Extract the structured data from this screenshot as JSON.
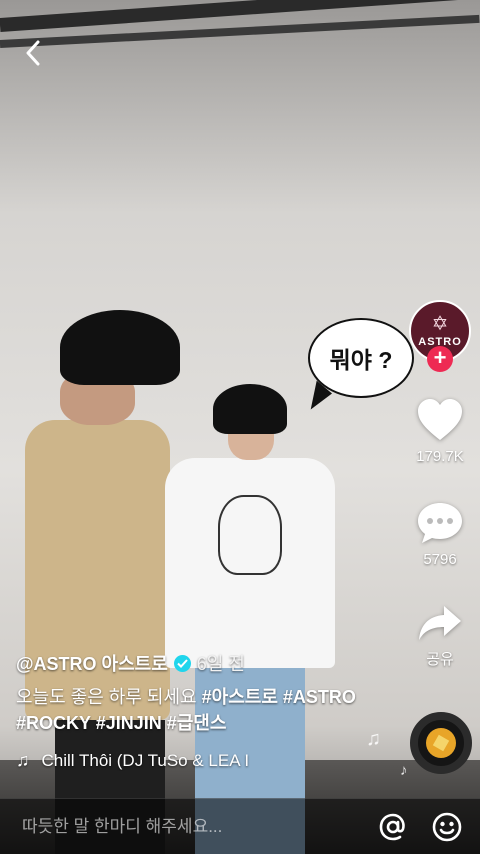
{
  "bubble_text": "뭐야 ?",
  "profile": {
    "avatar_text": "ASTRO",
    "follow_symbol": "+"
  },
  "rail": {
    "likes": "179.7K",
    "comments": "5796",
    "share_label": "공유"
  },
  "post": {
    "author": "@ASTRO 아스트로",
    "age": "6일 전",
    "text": "오늘도 좋은 하루 되세요",
    "hashtags_line1": "#아스트로 #ASTRO",
    "hashtags_line2": "#ROCKY #JINJIN #급댄스",
    "music": "Chill Thôi (DJ TuSo & LEA I"
  },
  "comment": {
    "placeholder": "따듯한 말 한마디 해주세요..."
  },
  "colors": {
    "accent": "#ee2a53",
    "verified": "#20d5ec",
    "avatar_bg": "#5a1a2a"
  },
  "icons": {
    "back": "chevron-left-icon",
    "like": "heart-icon",
    "comment": "speech-bubble-icon",
    "share": "share-arrow-icon",
    "music": "music-note-icon",
    "mention": "at-sign-icon",
    "emoji": "smiley-icon"
  }
}
